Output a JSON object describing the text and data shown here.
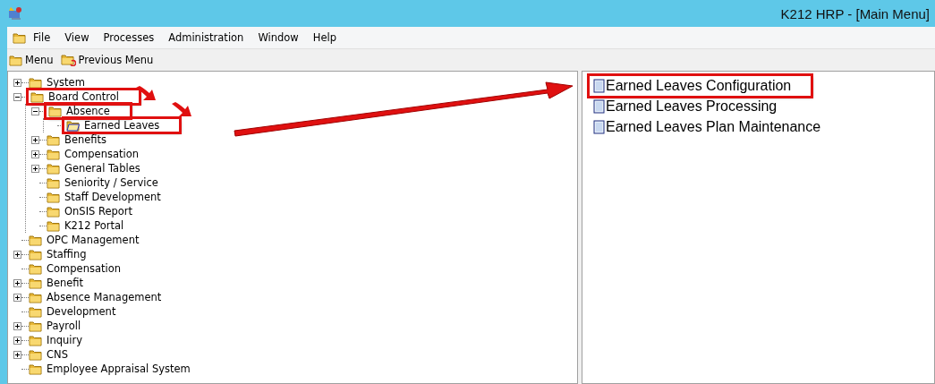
{
  "window": {
    "title": "K212 HRP - [Main Menu]"
  },
  "menu_bar": [
    "File",
    "View",
    "Processes",
    "Administration",
    "Window",
    "Help"
  ],
  "toolbar": [
    {
      "label": "Menu",
      "kind": "folder"
    },
    {
      "label": "Previous Menu",
      "kind": "back"
    }
  ],
  "tree": [
    {
      "label": "System",
      "expanded": false,
      "selected": false
    },
    {
      "label": "Board Control",
      "expanded": true,
      "selected": false,
      "highlighted": true,
      "children": [
        {
          "label": "Absence",
          "expanded": true,
          "selected": false,
          "highlighted": true,
          "children": [
            {
              "label": "Earned Leaves",
              "selected": true,
              "highlighted": true
            }
          ]
        },
        {
          "label": "Benefits",
          "expanded": false,
          "selected": false
        },
        {
          "label": "Compensation",
          "expanded": false,
          "selected": false
        },
        {
          "label": "General Tables",
          "expanded": false,
          "selected": false
        },
        {
          "label": "Seniority / Service",
          "selected": false
        },
        {
          "label": "Staff Development",
          "selected": false
        },
        {
          "label": "OnSIS Report",
          "selected": false
        },
        {
          "label": "K212 Portal",
          "selected": false
        }
      ]
    },
    {
      "label": "OPC Management",
      "selected": false
    },
    {
      "label": "Staffing",
      "expanded": false,
      "selected": false
    },
    {
      "label": "Compensation",
      "selected": false
    },
    {
      "label": "Benefit",
      "expanded": false,
      "selected": false
    },
    {
      "label": "Absence Management",
      "expanded": false,
      "selected": false
    },
    {
      "label": "Development",
      "selected": false
    },
    {
      "label": "Payroll",
      "expanded": false,
      "selected": false
    },
    {
      "label": "Inquiry",
      "expanded": false,
      "selected": false
    },
    {
      "label": "CNS",
      "expanded": false,
      "selected": false
    },
    {
      "label": "Employee Appraisal System",
      "selected": false
    }
  ],
  "programs": [
    {
      "label": "Earned Leaves Configuration",
      "highlighted": true
    },
    {
      "label": "Earned Leaves Processing",
      "highlighted": false
    },
    {
      "label": "Earned Leaves Plan Maintenance",
      "highlighted": false
    }
  ]
}
